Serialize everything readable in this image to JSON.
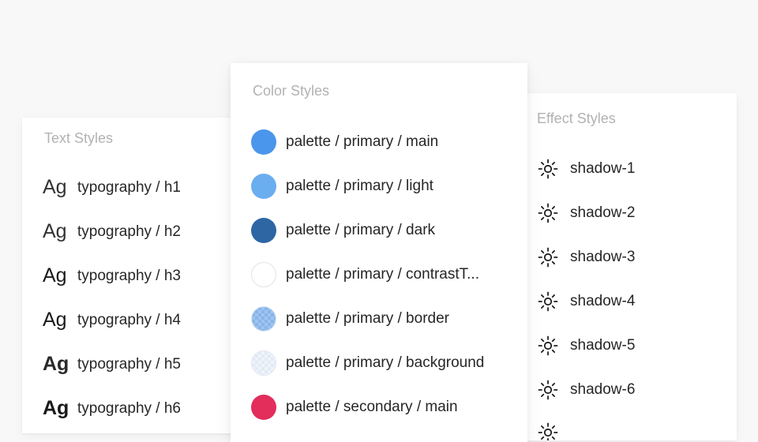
{
  "text_styles": {
    "title": "Text Styles",
    "sample": "Ag",
    "items": [
      {
        "label": "typography / h1"
      },
      {
        "label": "typography / h2"
      },
      {
        "label": "typography / h3"
      },
      {
        "label": "typography / h4"
      },
      {
        "label": "typography / h5"
      },
      {
        "label": "typography / h6"
      }
    ]
  },
  "color_styles": {
    "title": "Color Styles",
    "items": [
      {
        "label": "palette / primary / main",
        "color": "#4a96ec"
      },
      {
        "label": "palette / primary / light",
        "color": "#6aaef0"
      },
      {
        "label": "palette / primary / dark",
        "color": "#2d66a3"
      },
      {
        "label": "palette / primary / contrastT...",
        "color": "#ffffff"
      },
      {
        "label": "palette / primary / border",
        "color": "#4a96ec"
      },
      {
        "label": "palette / primary / background",
        "color": "#e6f0fc"
      },
      {
        "label": "palette / secondary / main",
        "color": "#e32d5a"
      }
    ]
  },
  "effect_styles": {
    "title": "Effect Styles",
    "icon": "sun-effect-icon",
    "items": [
      {
        "label": "shadow-1"
      },
      {
        "label": "shadow-2"
      },
      {
        "label": "shadow-3"
      },
      {
        "label": "shadow-4"
      },
      {
        "label": "shadow-5"
      },
      {
        "label": "shadow-6"
      }
    ]
  }
}
